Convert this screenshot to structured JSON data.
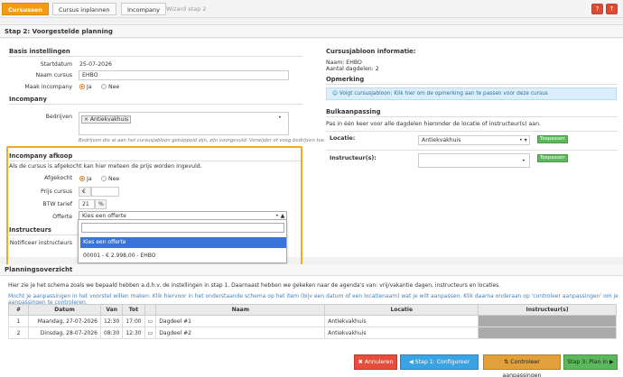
{
  "breadcrumbs": [
    "Cursussen",
    "Cursus inplannen",
    "Incompany",
    "Wizard stap 2"
  ],
  "top_icons": [
    "?",
    "↑"
  ],
  "step_title": "Stap 2: Voorgestelde planning",
  "basis": {
    "title": "Basis instellingen",
    "startdatum_label": "Startdatum",
    "startdatum": "25-07-2026",
    "naam_label": "Naam cursus",
    "naam": "EHBO",
    "incompany_label": "Maak incompany",
    "ja": "Ja",
    "nee": "Nee"
  },
  "incompany": {
    "title": "Incompany",
    "bedrijven_label": "Bedrijven",
    "bedrijf_tag": "× Antiekvakhuis",
    "hint": "Bedrijven die al aan het cursusjabloon gekoppeld zijn, zijn voorgevuld. Verwijder of voeg bedrijven toe."
  },
  "afkoop": {
    "title": "Incompany afkoop",
    "desc": "Als de cursus is afgekocht kan hier meteen de prijs worden ingevuld.",
    "afgekocht_label": "Afgekocht",
    "ja": "Ja",
    "nee": "Nee",
    "prijs_label": "Prijs cursus",
    "prijs_prefix": "€",
    "btw_label": "BTW tarief",
    "btw_value": "21",
    "btw_suffix": "%",
    "offerte_label": "Offerte",
    "offerte_selected": "Kies een offerte"
  },
  "instructeurs": {
    "title": "Instructeurs",
    "notificeer_label": "Notificeer instructeurs"
  },
  "dropdown": {
    "options": [
      "Kies een offerte",
      "00001 - € 2.998,00 - EHBO"
    ]
  },
  "right": {
    "jabloon_title": "Cursusjabloon informatie:",
    "naam_line": "Naam: EHBO",
    "dagdelen_line": "Aantal dagdelen: 2",
    "opmerking_title": "Opmerking",
    "opmerking_info": "☺ Volgt cursusjabloon: Klik hier om de opmerking aan te passen voor deze cursus",
    "bulk_title": "Bulkaanpassing",
    "bulk_desc": "Pas in één keer voor alle dagdelen hieronder de locatie of instructeur(s) aan.",
    "locatie_label": "Locatie:",
    "locatie_value": "Antiekvakhuis",
    "instructeur_label": "Instructeur(s):",
    "toepassen": "Toepassen"
  },
  "plan": {
    "title": "Planningsoverzicht",
    "line1": "Hier zie je het schema zoals we bepaald hebben a.d.h.v. de instellingen in stap 1. Daarnaast hebben we gekeken naar de agenda's van: vrij/vakantie dagen, instructeurs en locaties.",
    "line2": "Mocht je aanpassingen in het voorstel willen maken: Klik hiervoor in het onderstaande schema op het item (bijv een datum of een locatienaam) wat je wilt aanpassen. Klik daarna onderaan op 'controleer aanpassingen' om je aanpassingen te controleren.",
    "headers": [
      "#",
      "Datum",
      "Van",
      "Tot",
      "",
      "Naam",
      "Locatie",
      "Instructeur(s)"
    ],
    "rows": [
      [
        "1",
        "Maandag, 27-07-2026",
        "12:30",
        "17:00",
        "▭",
        "Dagdeel #1",
        "Antiekvakhuis",
        ""
      ],
      [
        "2",
        "Dinsdag, 28-07-2026",
        "08:30",
        "12:30",
        "▭",
        "Dagdeel #2",
        "Antiekvakhuis",
        ""
      ]
    ]
  },
  "buttons": {
    "annuleren": "✖ Annuleren",
    "stap1": "◀ Stap 1: Configureer wizard",
    "controleer": "⇅ Controleer aanpassingen",
    "stap3": "Stap 3: Plan in ▶"
  }
}
